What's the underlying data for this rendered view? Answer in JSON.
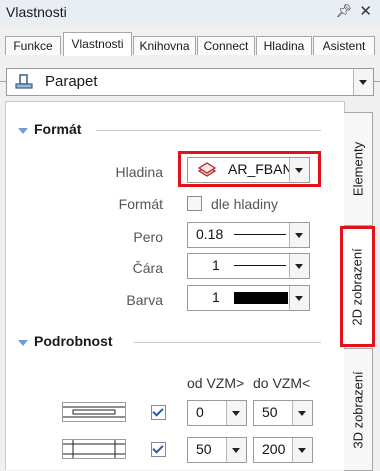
{
  "window": {
    "title": "Vlastnosti",
    "pin_icon": "pin-icon",
    "close_icon": "close-icon"
  },
  "tabs": [
    {
      "label": "Funkce"
    },
    {
      "label": "Vlastnosti",
      "active": true
    },
    {
      "label": "Knihovna"
    },
    {
      "label": "Connect"
    },
    {
      "label": "Hladina"
    },
    {
      "label": "Asistent"
    }
  ],
  "object_select": {
    "value": "Parapet",
    "icon": "parapet-icon"
  },
  "format_section": {
    "title": "Formát",
    "hladina": {
      "label": "Hladina",
      "value": "AR_FBAN",
      "icon": "layer-icon"
    },
    "format": {
      "label": "Formát",
      "checkbox_label": "dle hladiny",
      "checked": false
    },
    "pero": {
      "label": "Pero",
      "value": "0.18"
    },
    "cara": {
      "label": "Čára",
      "value": "1"
    },
    "barva": {
      "label": "Barva",
      "value": "1",
      "color": "#000000"
    }
  },
  "detail_section": {
    "title": "Podrobnost",
    "col_from": "od VZM>",
    "col_to": "do VZM<",
    "rows": [
      {
        "checked": true,
        "from": "0",
        "to": "50"
      },
      {
        "checked": true,
        "from": "50",
        "to": "200"
      }
    ]
  },
  "side_tabs": [
    {
      "label": "Elementy"
    },
    {
      "label": "2D zobrazení",
      "active": true
    },
    {
      "label": "3D zobrazení"
    }
  ],
  "colors": {
    "highlight": "#e3121a",
    "accent": "#6f9ed6"
  }
}
